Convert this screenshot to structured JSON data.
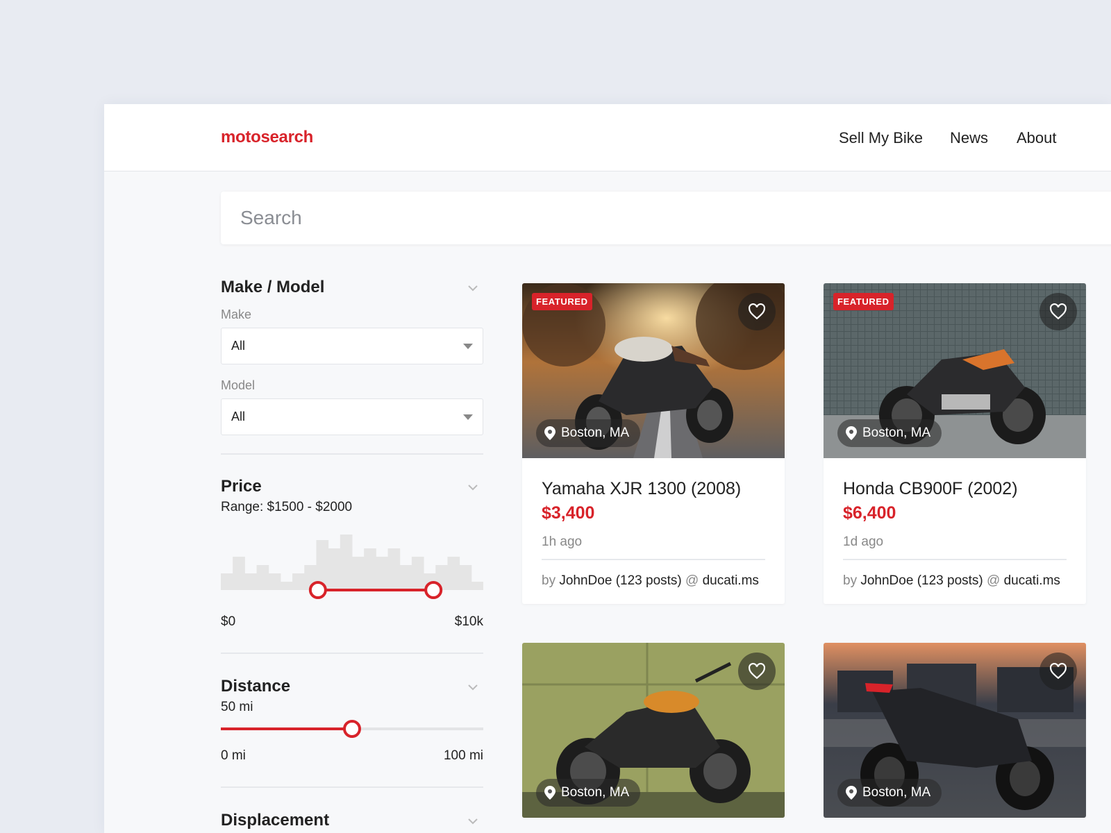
{
  "header": {
    "logo": "motosearch",
    "nav": [
      "Sell My Bike",
      "News",
      "About"
    ]
  },
  "search": {
    "placeholder": "Search"
  },
  "filters": {
    "make_model": {
      "title": "Make / Model",
      "make_label": "Make",
      "make_value": "All",
      "model_label": "Model",
      "model_value": "All"
    },
    "price": {
      "title": "Price",
      "range_text": "Range: $1500 - $2000",
      "min_label": "$0",
      "max_label": "$10k",
      "histogram": [
        2,
        4,
        2,
        3,
        2,
        1,
        2,
        3,
        6,
        5,
        7,
        4,
        5,
        4,
        5,
        3,
        4,
        2,
        3,
        4,
        3,
        1
      ],
      "low_fraction": 0.37,
      "high_fraction": 0.81
    },
    "distance": {
      "title": "Distance",
      "value_text": "50 mi",
      "min_label": "0 mi",
      "max_label": "100 mi",
      "fraction": 0.5
    },
    "displacement": {
      "title": "Displacement"
    }
  },
  "listings": [
    {
      "featured": "FEATURED",
      "location": "Boston, MA",
      "title": "Yamaha XJR 1300 (2008)",
      "price": "$3,400",
      "ago": "1h ago",
      "by_prefix": "by",
      "author": "JohnDoe (123 posts)",
      "at": "@",
      "site": "ducati.ms"
    },
    {
      "featured": "FEATURED",
      "location": "Boston, MA",
      "title": "Honda CB900F (2002)",
      "price": "$6,400",
      "ago": "1d ago",
      "by_prefix": "by",
      "author": "JohnDoe (123 posts)",
      "at": "@",
      "site": "ducati.ms"
    },
    {
      "location": "Boston, MA"
    },
    {
      "location": "Boston, MA"
    }
  ],
  "colors": {
    "accent": "#d8232a",
    "background": "#e8ebf2",
    "panel": "#f7f8fa"
  }
}
